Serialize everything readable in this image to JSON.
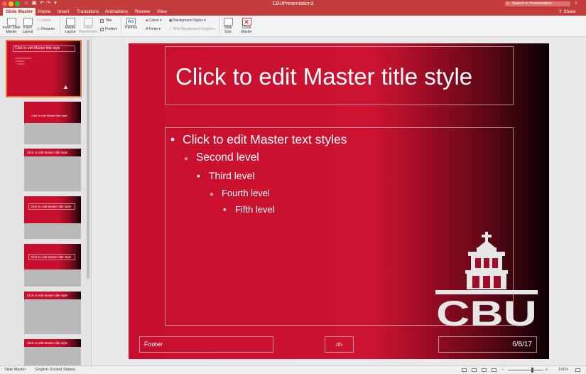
{
  "window": {
    "title": "CBUPresentation3"
  },
  "search": {
    "placeholder": "Search in Presentation"
  },
  "share": {
    "label": "Share"
  },
  "tabs": [
    {
      "label": "Slide Master",
      "active": true
    },
    {
      "label": "Home"
    },
    {
      "label": "Insert"
    },
    {
      "label": "Transitions"
    },
    {
      "label": "Animations"
    },
    {
      "label": "Review"
    },
    {
      "label": "View"
    }
  ],
  "ribbon": {
    "insert_slide_master": "Insert Slide Master",
    "insert_layout": "Insert Layout",
    "delete": "Delete",
    "rename": "Rename",
    "master_layout": "Master Layout",
    "insert_placeholder": "Insert Placeholder",
    "title_check": "Title",
    "footers_check": "Footers",
    "themes": "Themes",
    "colors": "Colors",
    "fonts": "Fonts",
    "background_styles": "Background Styles",
    "hide_background_graphics": "Hide Background Graphics",
    "slide_size": "Slide Size",
    "close_master": "Close Master"
  },
  "thumbnails": {
    "master_title": "Click to edit Master title style",
    "layout_title": "Click to edit Master title style"
  },
  "slide": {
    "title": "Click to edit Master title style",
    "levels": [
      "Click to edit Master text styles",
      "Second level",
      "Third level",
      "Fourth level",
      "Fifth level"
    ],
    "footer": "Footer",
    "slide_number": "‹#›",
    "date": "6/8/17",
    "logo_text": "CBU"
  },
  "status": {
    "view": "Slide Master",
    "language": "English (United States)",
    "zoom": "191%"
  },
  "colors": {
    "accent": "#c43b3b",
    "slide_red": "#c8102e"
  }
}
